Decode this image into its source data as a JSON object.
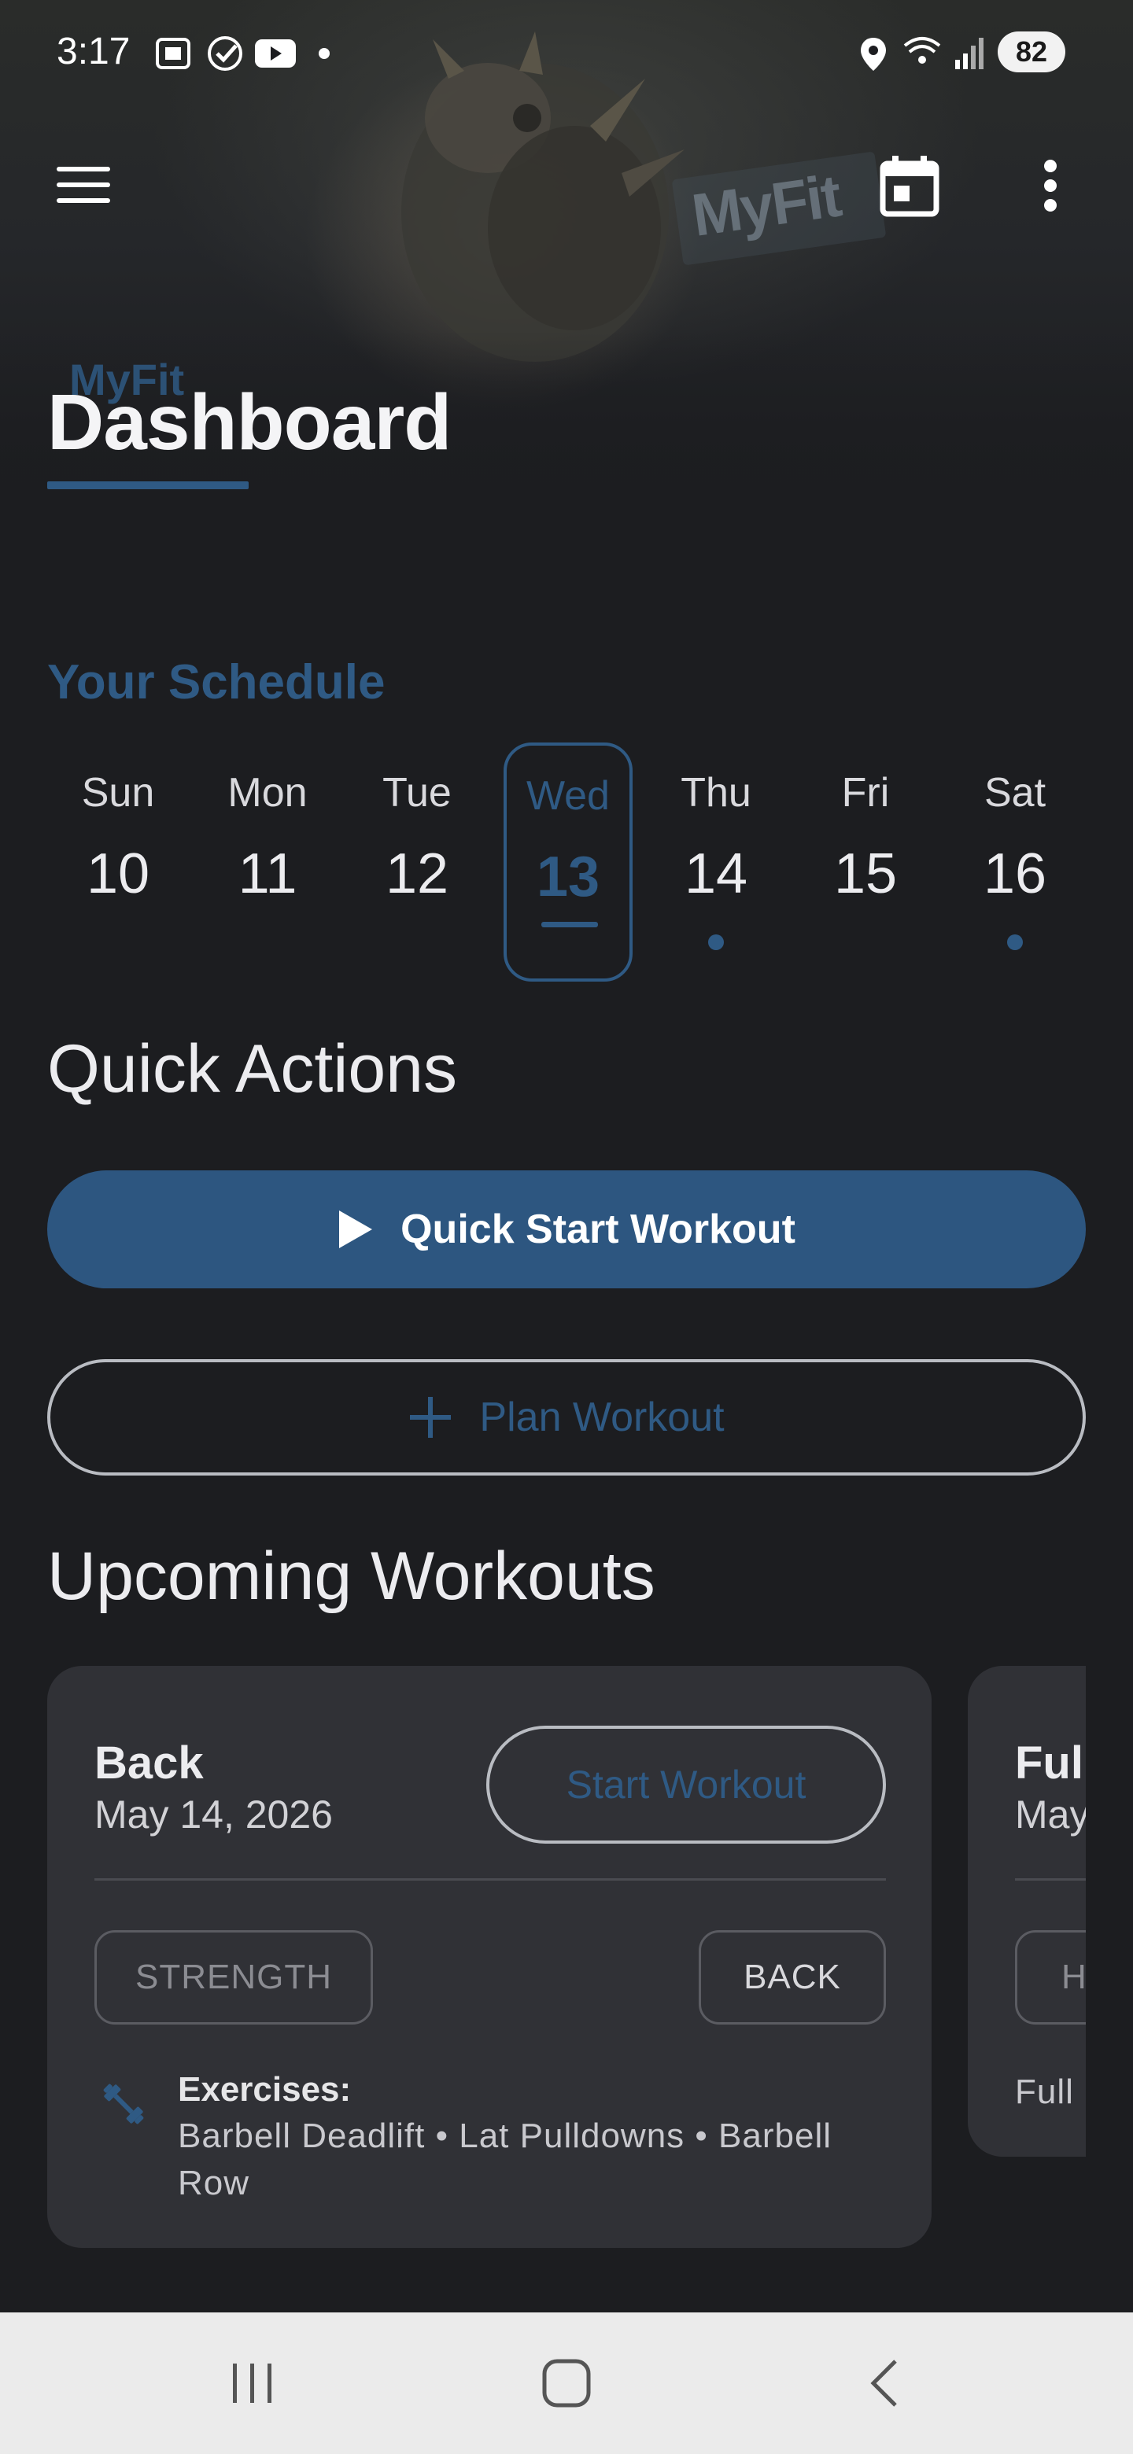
{
  "status_bar": {
    "time": "3:17",
    "battery": "82"
  },
  "hero": {
    "wall_sign_text": "MyFit"
  },
  "header": {
    "brand_small": "MyFit",
    "title": "Dashboard"
  },
  "schedule": {
    "heading": "Your Schedule",
    "days": [
      {
        "name": "Sun",
        "date": "10",
        "selected": false,
        "has_workout": false
      },
      {
        "name": "Mon",
        "date": "11",
        "selected": false,
        "has_workout": false
      },
      {
        "name": "Tue",
        "date": "12",
        "selected": false,
        "has_workout": false
      },
      {
        "name": "Wed",
        "date": "13",
        "selected": true,
        "has_workout": false
      },
      {
        "name": "Thu",
        "date": "14",
        "selected": false,
        "has_workout": true
      },
      {
        "name": "Fri",
        "date": "15",
        "selected": false,
        "has_workout": false
      },
      {
        "name": "Sat",
        "date": "16",
        "selected": false,
        "has_workout": true
      }
    ]
  },
  "quick_actions": {
    "heading": "Quick Actions",
    "quick_start_label": "Quick Start Workout",
    "plan_label": "Plan Workout"
  },
  "upcoming": {
    "heading": "Upcoming Workouts",
    "cards": [
      {
        "title": "Back",
        "date": "May 14, 2026",
        "start_label": "Start Workout",
        "type_chip": "STRENGTH",
        "muscle_chip": "BACK",
        "exercises_label": "Exercises:",
        "exercises_line1": "Barbell Deadlift • Lat Pulldowns • Barbell",
        "exercises_line2": "Row"
      },
      {
        "title_visible": "Full",
        "date_visible": "May",
        "chip_visible": "H",
        "body_visible": "Full"
      }
    ]
  },
  "colors": {
    "accent": "#2f5a84",
    "background": "#1c1d20",
    "card": "#303136",
    "nav_bar": "#ebebeb"
  },
  "icons": [
    "hamburger-menu-icon",
    "calendar-icon",
    "more-vert-icon",
    "play-icon",
    "plus-icon",
    "dumbbell-icon",
    "recents-icon",
    "home-icon",
    "back-icon"
  ]
}
